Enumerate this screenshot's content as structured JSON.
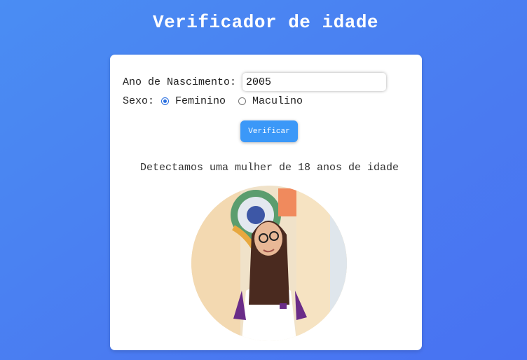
{
  "page": {
    "title": "Verificador de idade"
  },
  "form": {
    "year_label": "Ano de Nascimento:",
    "year_value": "2005",
    "sex_label": "Sexo:",
    "options": [
      {
        "label": "Feminino",
        "checked": true
      },
      {
        "label": "Maculino",
        "checked": false
      }
    ],
    "verify_label": "Verificar"
  },
  "result": {
    "message": "Detectamos uma mulher de 18 anos de idade",
    "image_icon": "photo-of-young-woman"
  },
  "colors": {
    "background_start": "#4a8df3",
    "background_end": "#4872f2",
    "button": "#3b98f8",
    "radio_accent": "#2a6fe0"
  }
}
